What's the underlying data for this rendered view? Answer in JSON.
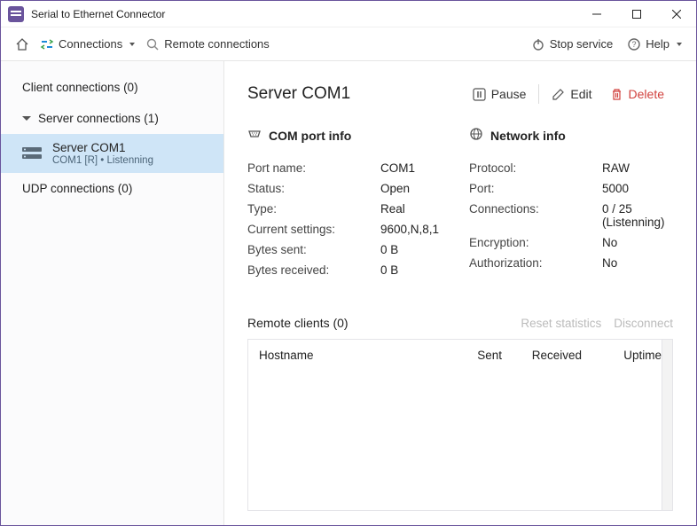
{
  "titlebar": {
    "title": "Serial to Ethernet Connector"
  },
  "toolbar": {
    "connections": "Connections",
    "remote": "Remote connections",
    "stop_service": "Stop service",
    "help": "Help"
  },
  "sidebar": {
    "client_h": "Client connections (0)",
    "server_h": "Server connections (1)",
    "udp_h": "UDP connections (0)",
    "server_item": {
      "title": "Server COM1",
      "sub": "COM1 [R] • Listenning"
    }
  },
  "main": {
    "title": "Server COM1",
    "actions": {
      "pause": "Pause",
      "edit": "Edit",
      "delete": "Delete"
    },
    "com_h": "COM port info",
    "net_h": "Network info",
    "com": {
      "port_name_k": "Port name:",
      "port_name_v": "COM1",
      "status_k": "Status:",
      "status_v": "Open",
      "type_k": "Type:",
      "type_v": "Real",
      "settings_k": "Current settings:",
      "settings_v": "9600,N,8,1",
      "bsent_k": "Bytes sent:",
      "bsent_v": "0 B",
      "brecv_k": "Bytes received:",
      "brecv_v": "0 B"
    },
    "net": {
      "proto_k": "Protocol:",
      "proto_v": "RAW",
      "port_k": "Port:",
      "port_v": "5000",
      "conn_k": "Connections:",
      "conn_v": "0 / 25 (Listenning)",
      "enc_k": "Encryption:",
      "enc_v": "No",
      "auth_k": "Authorization:",
      "auth_v": "No"
    },
    "remote_h": "Remote clients (0)",
    "reset": "Reset statistics",
    "disconnect": "Disconnect",
    "thead": {
      "host": "Hostname",
      "sent": "Sent",
      "recv": "Received",
      "uptime": "Uptime"
    }
  }
}
